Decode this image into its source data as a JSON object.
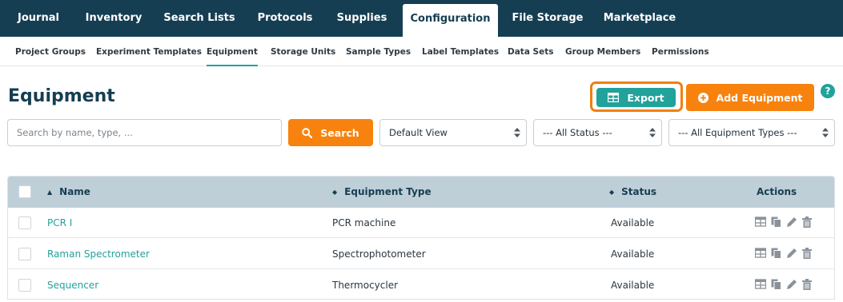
{
  "topnav": {
    "tabs": [
      {
        "label": "Journal",
        "active": false
      },
      {
        "label": "Inventory",
        "active": false
      },
      {
        "label": "Search Lists",
        "active": false
      },
      {
        "label": "Protocols",
        "active": false
      },
      {
        "label": "Supplies",
        "active": false
      },
      {
        "label": "Configuration",
        "active": true
      },
      {
        "label": "File Storage",
        "active": false
      },
      {
        "label": "Marketplace",
        "active": false
      }
    ]
  },
  "subnav": {
    "items": [
      {
        "label": "Project Groups",
        "active": false
      },
      {
        "label": "Experiment Templates",
        "active": false
      },
      {
        "label": "Equipment",
        "active": true
      },
      {
        "label": "Storage Units",
        "active": false
      },
      {
        "label": "Sample Types",
        "active": false
      },
      {
        "label": "Label Templates",
        "active": false
      },
      {
        "label": "Data Sets",
        "active": false
      },
      {
        "label": "Group Members",
        "active": false
      },
      {
        "label": "Permissions",
        "active": false
      }
    ]
  },
  "page": {
    "title": "Equipment",
    "export_label": "Export",
    "add_label": "Add Equipment",
    "help_label": "?"
  },
  "filters": {
    "search_placeholder": "Search by name, type, ...",
    "search_value": "",
    "search_label": "Search",
    "view_select": "Default View",
    "status_select": "--- All Status ---",
    "type_select": "--- All Equipment Types ---"
  },
  "table": {
    "columns": {
      "name": "Name",
      "type": "Equipment Type",
      "status": "Status",
      "actions": "Actions"
    },
    "rows": [
      {
        "name": "PCR I",
        "type": "PCR machine",
        "status": "Available"
      },
      {
        "name": "Raman Spectrometer",
        "type": "Spectrophotometer",
        "status": "Available"
      },
      {
        "name": "Sequencer",
        "type": "Thermocycler",
        "status": "Available"
      }
    ]
  },
  "colors": {
    "nav_bg": "#163e52",
    "accent_teal": "#21a29a",
    "accent_orange": "#f7830e",
    "table_header_bg": "#bfcfd8"
  },
  "icons": {
    "export": "table-grid-icon",
    "add": "plus-circle-icon",
    "search": "magnifier-icon",
    "row_actions": [
      "table-grid-icon",
      "copy-icon",
      "pencil-icon",
      "trash-icon"
    ]
  }
}
